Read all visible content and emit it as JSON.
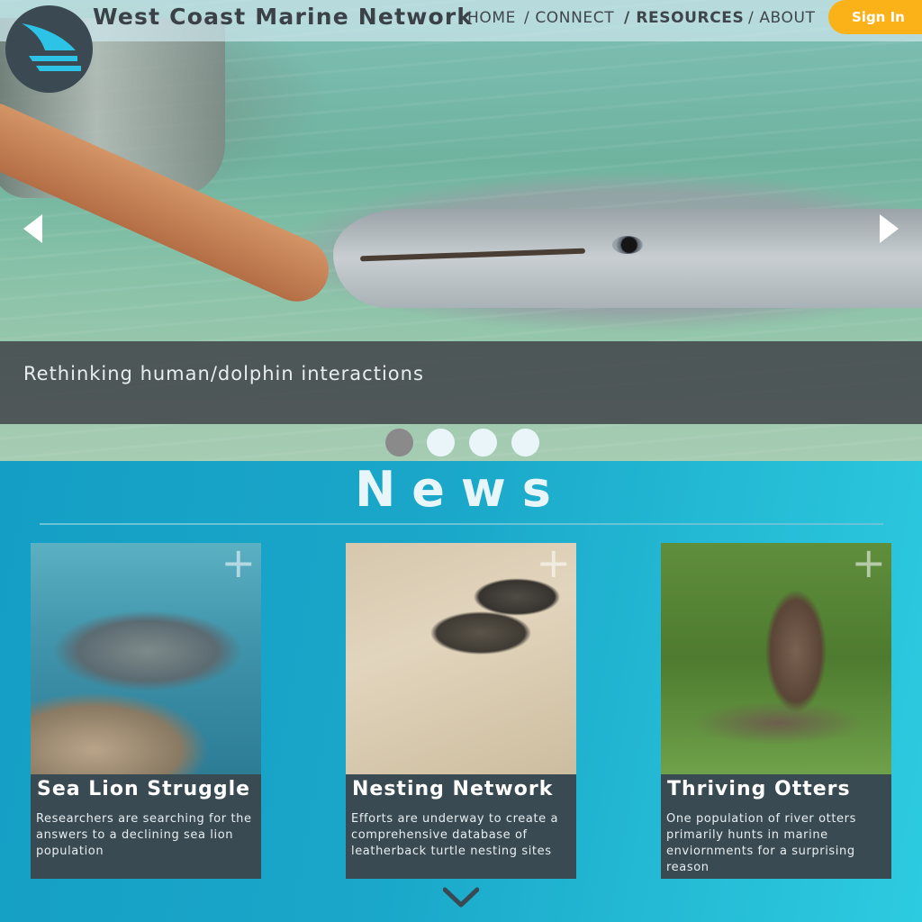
{
  "header": {
    "site_title": "West Coast Marine Network",
    "nav": [
      {
        "label": "HOME"
      },
      {
        "label": "/ CONNECT"
      },
      {
        "label": "/ RESOURCES",
        "active": true
      },
      {
        "label": "/ ABOUT"
      }
    ],
    "sign_in_label": "Sign In"
  },
  "hero": {
    "caption": "Rethinking human/dolphin interactions",
    "slides_total": 4,
    "active_slide": 1,
    "prev_icon": "chevron-left-icon",
    "next_icon": "chevron-right-icon"
  },
  "news": {
    "title": "News",
    "cards": [
      {
        "title": "Sea Lion Struggle",
        "text": "Researchers are searching for the answers to a declining sea lion population"
      },
      {
        "title": "Nesting Network",
        "text": "Efforts are underway to create a comprehensive database of leatherback turtle nesting sites"
      },
      {
        "title": "Thriving Otters",
        "text": "One population of river otters primarily hunts in marine enviornments for a surprising reason"
      }
    ],
    "expand_icon": "plus-icon",
    "scroll_icon": "chevron-down-icon"
  },
  "colors": {
    "accent": "#fbb219",
    "card_body": "#394a52",
    "news_bg": "#1aa7c9"
  }
}
